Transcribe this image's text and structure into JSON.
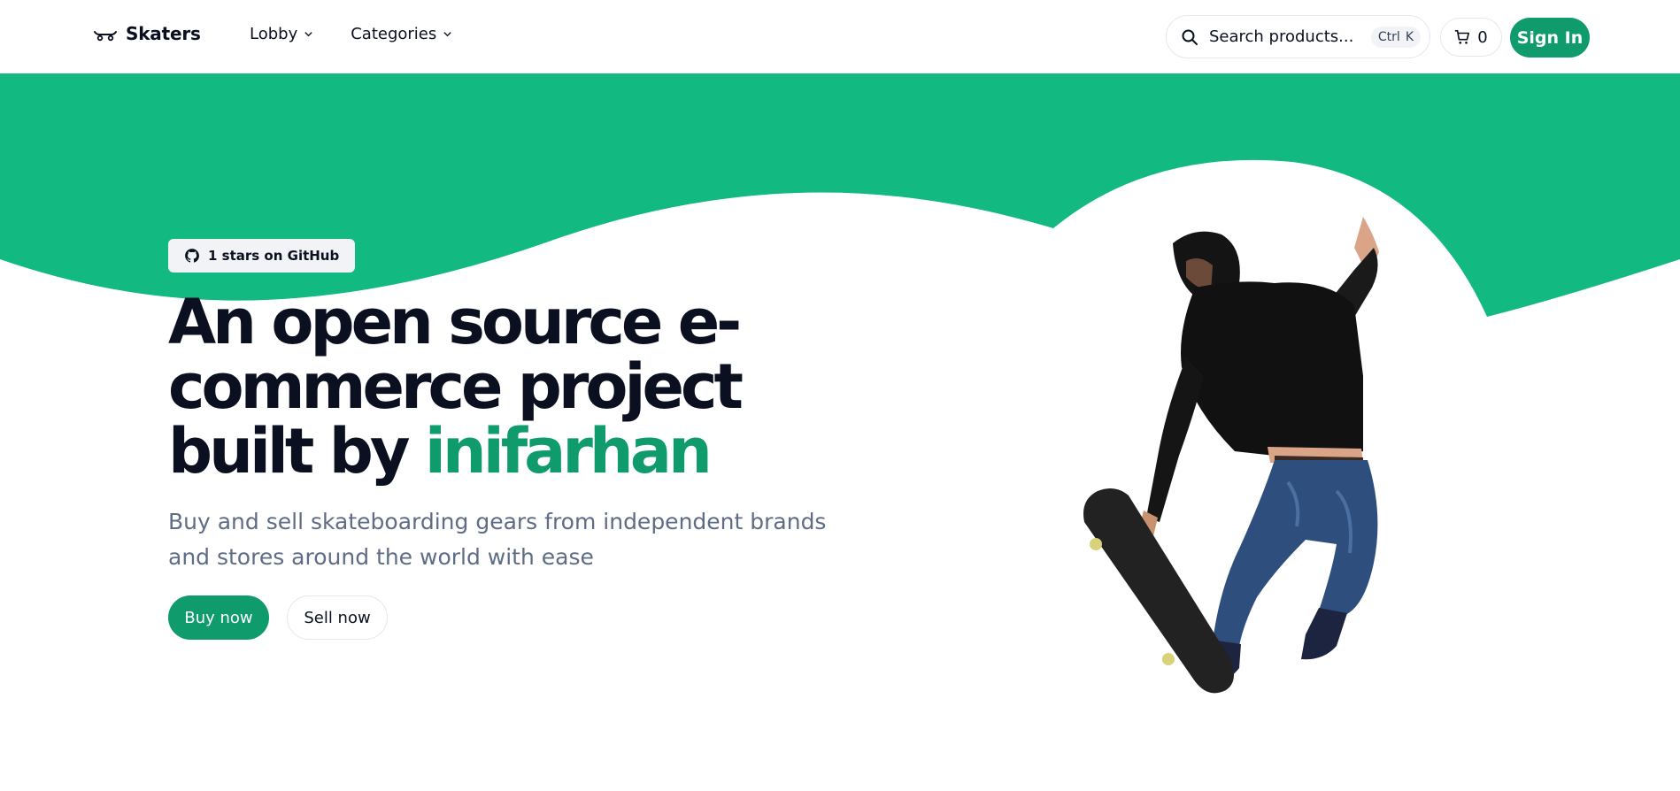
{
  "colors": {
    "accent": "#0f9b6b",
    "wave": "#12b981",
    "text": "#0b1020",
    "muted": "#5f6c85"
  },
  "header": {
    "brand": {
      "icon": "skateboard-icon",
      "name": "Skaters"
    },
    "nav": [
      {
        "label": "Lobby",
        "icon": "chevron-down-icon"
      },
      {
        "label": "Categories",
        "icon": "chevron-down-icon"
      }
    ],
    "search": {
      "icon": "search-icon",
      "placeholder": "Search products...",
      "shortcut": [
        "Ctrl",
        "K"
      ]
    },
    "cart": {
      "icon": "cart-icon",
      "count": "0"
    },
    "sign_in_label": "Sign In"
  },
  "hero": {
    "badge": {
      "icon": "github-icon",
      "text": "1 stars on GitHub"
    },
    "headline_main": "An open source e-commerce project built by",
    "headline_accent": "inifarhan",
    "subtitle": "Buy and sell skateboarding gears from independent brands and stores around the world with ease",
    "buy_label": "Buy now",
    "sell_label": "Sell now"
  }
}
